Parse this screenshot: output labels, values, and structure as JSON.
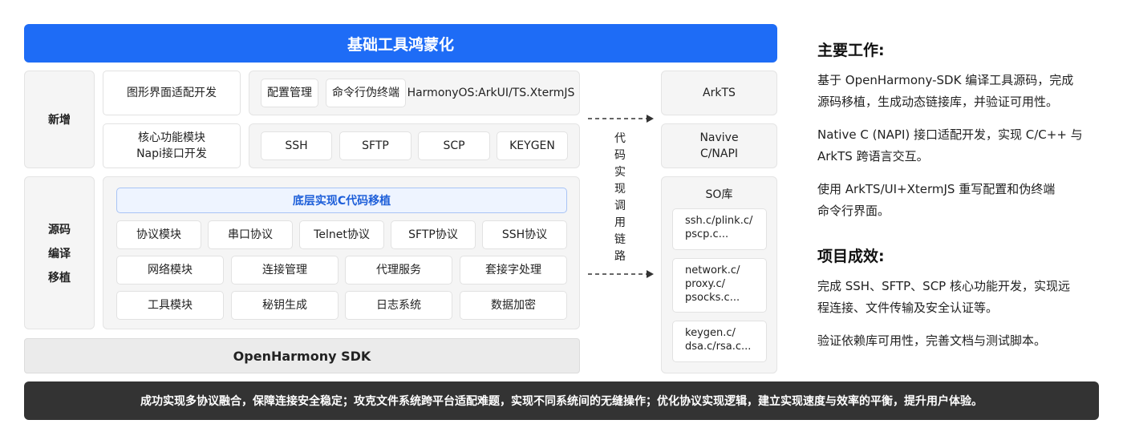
{
  "title": "基础工具鸿蒙化",
  "added": {
    "label": "新增",
    "row1": {
      "box1": "图形界面适配开发",
      "chips": [
        "配置管理",
        "命令行伪终端"
      ],
      "extra": "HarmonyOS:ArkUI/TS.XtermJS"
    },
    "row2": {
      "box1_line1": "核心功能模块",
      "box1_line2": "Napi接口开发",
      "chips": [
        "SSH",
        "SFTP",
        "SCP",
        "KEYGEN"
      ]
    }
  },
  "porting": {
    "label_lines": [
      "源码",
      "编译",
      "移植"
    ],
    "header": "底层实现C代码移植",
    "row1": [
      "协议模块",
      "串口协议",
      "Telnet协议",
      "SFTP协议",
      "SSH协议"
    ],
    "row2": [
      "网络模块",
      "连接管理",
      "代理服务",
      "套接字处理"
    ],
    "row3": [
      "工具模块",
      "秘钥生成",
      "日志系统",
      "数据加密"
    ]
  },
  "sdk": "OpenHarmony SDK",
  "link_label_chars": [
    "代",
    "码",
    "实",
    "现",
    "调",
    "用",
    "链",
    "路"
  ],
  "right_stack": {
    "arkts": "ArkTS",
    "native_line1": "Navive",
    "native_line2": "C/NAPI",
    "so_title": "SO库",
    "so_items": [
      [
        "ssh.c/plink.c/",
        "pscp.c..."
      ],
      [
        "network.c/",
        "proxy.c/",
        "psocks.c..."
      ],
      [
        "keygen.c/",
        "dsa.c/rsa.c..."
      ]
    ]
  },
  "summary": "成功实现多协议融合，保障连接安全稳定；攻克文件系统跨平台适配难题，实现不同系统间的无缝操作；优化协议实现逻辑，建立实现速度与效率的平衡，提升用户体验。",
  "main_work": {
    "title": "主要工作:",
    "p1_l1": "基于 OpenHarmony-SDK 编译工具源码，完成",
    "p1_l2": "源码移植，生成动态链接库，并验证可用性。",
    "p2_l1": "Native C (NAPI) 接口适配开发，实现 C/C++ 与",
    "p2_l2": "ArkTS 跨语言交互。",
    "p3_l1": "使用 ArkTS/UI+XtermJS 重写配置和伪终端",
    "p3_l2": "命令行界面。"
  },
  "results": {
    "title": "项目成效:",
    "p1_l1": "完成 SSH、SFTP、SCP 核心功能开发，实现远",
    "p1_l2": "程连接、文件传输及安全认证等。",
    "p2_l1": "验证依赖库可用性，完善文档与测试脚本。"
  },
  "colors": {
    "accent": "#1e6cf6",
    "dark": "#333333",
    "panel": "#f5f5f5"
  }
}
